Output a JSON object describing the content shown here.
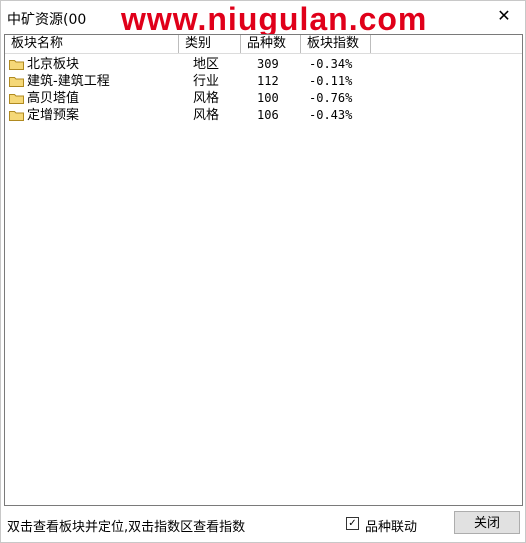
{
  "window": {
    "title": "中矿资源(00",
    "watermark": "www.niugulan.com",
    "close_label": "✕"
  },
  "table": {
    "columns": [
      "板块名称",
      "类别",
      "品种数",
      "板块指数"
    ],
    "rows": [
      {
        "name": "北京板块",
        "category": "地区",
        "count": "309",
        "index": "-0.34%"
      },
      {
        "name": "建筑-建筑工程",
        "category": "行业",
        "count": "112",
        "index": "-0.11%"
      },
      {
        "name": "高贝塔值",
        "category": "风格",
        "count": "100",
        "index": "-0.76%"
      },
      {
        "name": "定增预案",
        "category": "风格",
        "count": "106",
        "index": "-0.43%"
      }
    ]
  },
  "status": {
    "hint": "双击查看板块并定位,双击指数区查看指数",
    "checkbox_label": "品种联动",
    "checkbox_checked": true,
    "close_button": "关闭"
  },
  "colors": {
    "watermark": "#e0001a",
    "folder": "#e8c860"
  }
}
